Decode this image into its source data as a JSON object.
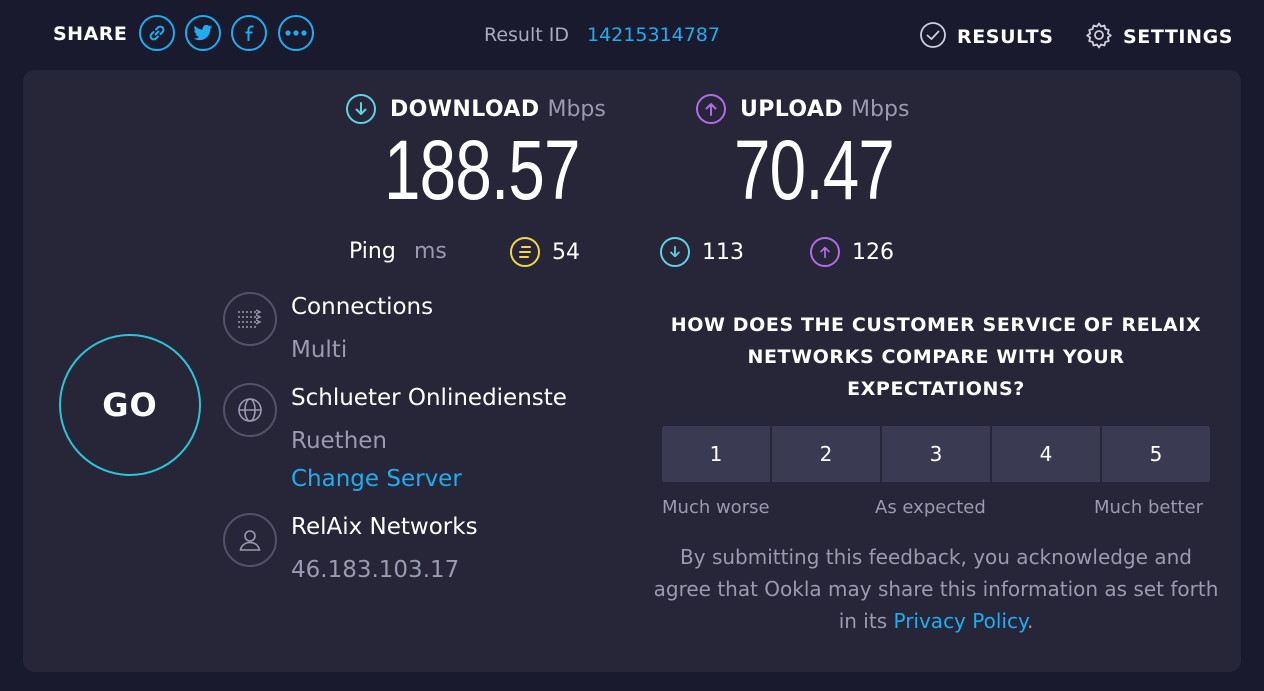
{
  "share": {
    "label": "SHARE",
    "icons": [
      "link-icon",
      "twitter-icon",
      "facebook-icon",
      "more-icon"
    ]
  },
  "result": {
    "label": "Result ID",
    "id": "14215314787"
  },
  "nav": {
    "results_label": "RESULTS",
    "settings_label": "SETTINGS"
  },
  "download": {
    "title": "DOWNLOAD",
    "unit": "Mbps",
    "value": "188.57",
    "color": "#5fd3e4"
  },
  "upload": {
    "title": "UPLOAD",
    "unit": "Mbps",
    "value": "70.47",
    "color": "#b06ce6"
  },
  "ping": {
    "label": "Ping",
    "unit": "ms",
    "idle": "54",
    "download": "113",
    "upload": "126",
    "idle_color": "#f3d74a"
  },
  "go_label": "GO",
  "connections": {
    "title": "Connections",
    "value": "Multi"
  },
  "server": {
    "name": "Schlueter Onlinedienste",
    "location": "Ruethen",
    "change_label": "Change Server"
  },
  "provider": {
    "name": "RelAix Networks",
    "ip": "46.183.103.17"
  },
  "survey": {
    "question": "HOW DOES THE CUSTOMER SERVICE OF RELAIX NETWORKS COMPARE WITH YOUR EXPECTATIONS?",
    "ratings": [
      "1",
      "2",
      "3",
      "4",
      "5"
    ],
    "scale_low": "Much worse",
    "scale_mid": "As expected",
    "scale_high": "Much better",
    "disclaimer_pre": "By submitting this feedback, you acknowledge and agree that Ookla may share this information as set forth in its",
    "privacy_label": "Privacy Policy",
    "disclaimer_post": "."
  },
  "colors": {
    "accent": "#1eadf0",
    "background": "#1a1a2e",
    "panel": "#262638",
    "go_ring": "#2bc4d8"
  }
}
